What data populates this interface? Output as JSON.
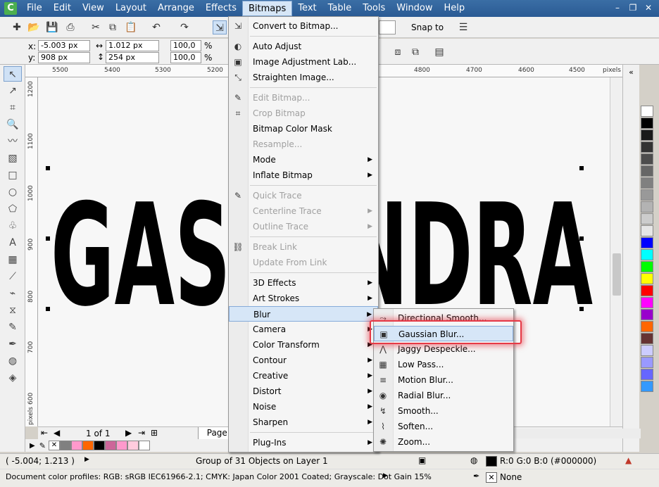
{
  "menubar": {
    "items": [
      "File",
      "Edit",
      "View",
      "Layout",
      "Arrange",
      "Effects",
      "Bitmaps",
      "Text",
      "Table",
      "Tools",
      "Window",
      "Help"
    ],
    "active": "Bitmaps"
  },
  "toolbar": {
    "snap_label": "Snap to"
  },
  "props": {
    "x_label": "x:",
    "x_value": "-5.003 px",
    "y_label": "y:",
    "y_value": "908 px",
    "w_value": "1.012 px",
    "h_value": "254 px",
    "scale_w": "100,0",
    "scale_h": "100,0",
    "pct": "%"
  },
  "ruler": {
    "top": [
      "5500",
      "5400",
      "5300",
      "5200",
      "4800",
      "4700",
      "4600",
      "4500",
      "pixels"
    ],
    "left": [
      "1200",
      "1100",
      "1000",
      "900",
      "800",
      "700",
      "600",
      "pixels"
    ]
  },
  "canvas": {
    "text": "GASSANDRA"
  },
  "bitmaps_menu": {
    "items": [
      {
        "label": "Convert to Bitmap...",
        "disabled": false,
        "submenu": false
      },
      {
        "sep": true
      },
      {
        "label": "Auto Adjust",
        "disabled": false,
        "submenu": false
      },
      {
        "label": "Image Adjustment Lab...",
        "disabled": false,
        "submenu": false
      },
      {
        "label": "Straighten Image...",
        "disabled": false,
        "submenu": false
      },
      {
        "sep": true
      },
      {
        "label": "Edit Bitmap...",
        "disabled": true,
        "submenu": false
      },
      {
        "label": "Crop Bitmap",
        "disabled": true,
        "submenu": false
      },
      {
        "label": "Bitmap Color Mask",
        "disabled": false,
        "submenu": false
      },
      {
        "label": "Resample...",
        "disabled": true,
        "submenu": false
      },
      {
        "label": "Mode",
        "disabled": false,
        "submenu": true
      },
      {
        "label": "Inflate Bitmap",
        "disabled": false,
        "submenu": true
      },
      {
        "sep": true
      },
      {
        "label": "Quick Trace",
        "disabled": true,
        "submenu": false
      },
      {
        "label": "Centerline Trace",
        "disabled": true,
        "submenu": true
      },
      {
        "label": "Outline Trace",
        "disabled": true,
        "submenu": true
      },
      {
        "sep": true
      },
      {
        "label": "Break Link",
        "disabled": true,
        "submenu": false
      },
      {
        "label": "Update From Link",
        "disabled": true,
        "submenu": false
      },
      {
        "sep": true
      },
      {
        "label": "3D Effects",
        "disabled": false,
        "submenu": true
      },
      {
        "label": "Art Strokes",
        "disabled": false,
        "submenu": true
      },
      {
        "label": "Blur",
        "disabled": false,
        "submenu": true,
        "highlighted": true
      },
      {
        "label": "Camera",
        "disabled": false,
        "submenu": true
      },
      {
        "label": "Color Transform",
        "disabled": false,
        "submenu": true
      },
      {
        "label": "Contour",
        "disabled": false,
        "submenu": true
      },
      {
        "label": "Creative",
        "disabled": false,
        "submenu": true
      },
      {
        "label": "Distort",
        "disabled": false,
        "submenu": true
      },
      {
        "label": "Noise",
        "disabled": false,
        "submenu": true
      },
      {
        "label": "Sharpen",
        "disabled": false,
        "submenu": true
      },
      {
        "sep": true
      },
      {
        "label": "Plug-Ins",
        "disabled": false,
        "submenu": true
      }
    ]
  },
  "blur_menu": {
    "items": [
      {
        "label": "Directional Smooth...",
        "icon": "directional-smooth-icon"
      },
      {
        "label": "Gaussian Blur...",
        "icon": "gaussian-blur-icon",
        "highlighted": true
      },
      {
        "label": "Jaggy Despeckle...",
        "icon": "jaggy-despeckle-icon"
      },
      {
        "label": "Low Pass...",
        "icon": "low-pass-icon"
      },
      {
        "label": "Motion Blur...",
        "icon": "motion-blur-icon"
      },
      {
        "label": "Radial Blur...",
        "icon": "radial-blur-icon"
      },
      {
        "label": "Smooth...",
        "icon": "smooth-icon"
      },
      {
        "label": "Soften...",
        "icon": "soften-icon"
      },
      {
        "label": "Zoom...",
        "icon": "zoom-blur-icon"
      }
    ]
  },
  "pagenav": {
    "page_count": "1 of 1",
    "page_tab": "Page 1"
  },
  "status": {
    "coords": "( -5.004; 1.213 )",
    "object_info": "Group of 31 Objects on Layer 1",
    "fill": "R:0 G:0 B:0 (#000000)",
    "outline": "None",
    "profiles": "Document color profiles: RGB: sRGB IEC61966-2.1; CMYK: Japan Color 2001 Coated; Grayscale: Dot Gain 15%"
  },
  "palette_colors": [
    "#ffffff",
    "#000000",
    "#1a1a1a",
    "#333333",
    "#4d4d4d",
    "#666666",
    "#808080",
    "#999999",
    "#b3b3b3",
    "#cccccc",
    "#e6e6e6",
    "#0000ff",
    "#00ffff",
    "#00ff00",
    "#ffff00",
    "#ff0000",
    "#ff00ff",
    "#9900cc",
    "#ff6600",
    "#663333",
    "#ccccff",
    "#9999ff",
    "#6666ff",
    "#3399ff"
  ],
  "doc_palette_colors": [
    "#808080",
    "#ff99cc",
    "#ff6600",
    "#000000",
    "#cc6699",
    "#ff99cc",
    "#ffccdd",
    "#ffffff"
  ]
}
